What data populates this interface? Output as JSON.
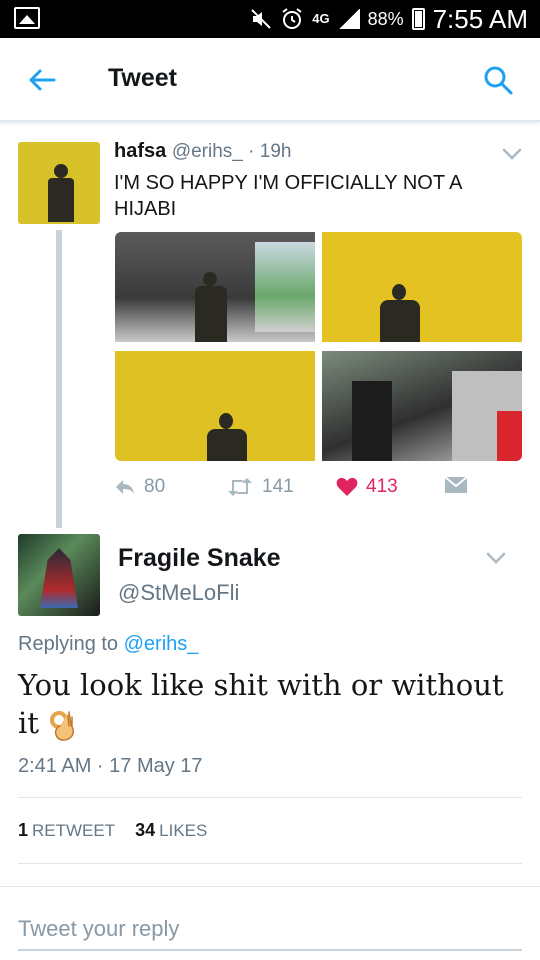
{
  "status_bar": {
    "battery": "88%",
    "network": "4G",
    "time": "7:55 AM"
  },
  "header": {
    "title": "Tweet",
    "back_icon": "arrow-left-icon",
    "search_icon": "search-icon"
  },
  "original_tweet": {
    "name": "hafsa",
    "handle": "@erihs_",
    "separator": " · ",
    "age": "19h",
    "text": "I'M SO HAPPY I'M OFFICIALLY NOT A HIJABI",
    "replies": "80",
    "retweets": "141",
    "likes": "413"
  },
  "reply_tweet": {
    "name": "Fragile Snake",
    "handle": "@StMeLoFli",
    "replying_prefix": "Replying to ",
    "replying_to": "@erihs_",
    "text": "You look like shit with or without it",
    "timestamp": "2:41 AM · 17 May 17",
    "retweet_count": "1",
    "retweet_label": "RETWEET",
    "like_count": "34",
    "like_label": "LIKES"
  },
  "compose": {
    "placeholder": "Tweet your reply"
  },
  "colors": {
    "brand_blue": "#1da1f2",
    "like_red": "#e0245e",
    "muted": "#657786"
  }
}
